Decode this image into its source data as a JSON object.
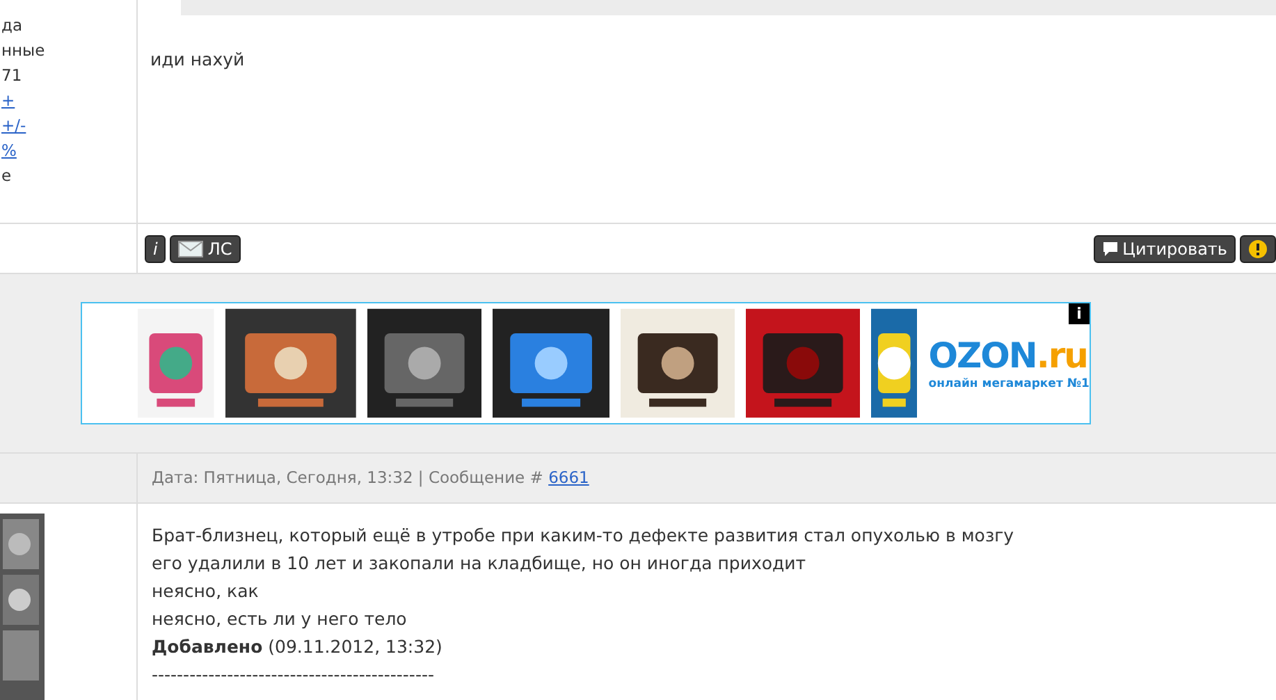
{
  "profile_fragments": [
    {
      "text": "да",
      "link": false
    },
    {
      "text": "нные",
      "link": false
    },
    {
      "text": "71",
      "link": false
    },
    {
      "text": "+",
      "link": true
    },
    {
      "text": "+/-",
      "link": true
    },
    {
      "text": "%",
      "link": true
    },
    {
      "text": "е",
      "link": false
    }
  ],
  "post_text": "иди нахуй",
  "post_buttons_left": [
    {
      "kind": "info",
      "label": "i"
    },
    {
      "kind": "pm",
      "label": "ЛС"
    }
  ],
  "post_buttons_right": [
    {
      "kind": "quote",
      "label": "Цитировать"
    },
    {
      "kind": "report"
    }
  ],
  "ad": {
    "badge": "i",
    "logo_main": "OZON",
    "logo_tld": ".ru",
    "tagline": "онлайн мегамаркет №1"
  },
  "next_post": {
    "date_text": "Дата: Пятница, Сегодня, 13:32 | Сообщение # ",
    "number": "6661",
    "lines": [
      "Брат-близнец, который ещё в утробе при каким-то дефекте развития стал опухолью в мозгу",
      "его удалили в 10 лет и закопали на кладбище, но он иногда приходит",
      "неясно, как",
      "неясно, есть ли у него тело"
    ],
    "added_label": "Добавлено",
    "added_time": " (09.11.2012, 13:32)",
    "separator": "---------------------------------------------"
  }
}
